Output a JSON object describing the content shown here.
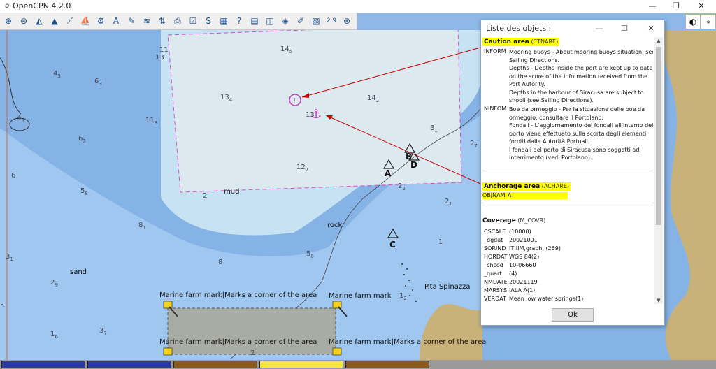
{
  "window": {
    "title": "OpenCPN 4.2.0",
    "minimize": "—",
    "restore": "❐",
    "close": "✕"
  },
  "toolbar": {
    "tools": [
      {
        "name": "zoom-in-icon",
        "glyph": "⊕"
      },
      {
        "name": "zoom-out-icon",
        "glyph": "⊖"
      },
      {
        "name": "scale-in-icon",
        "glyph": "◭"
      },
      {
        "name": "scale-out-icon",
        "glyph": "▲"
      },
      {
        "name": "route-icon",
        "glyph": "⟋"
      },
      {
        "name": "ship-icon",
        "glyph": "⛵"
      },
      {
        "name": "settings-icon",
        "glyph": "⚙"
      },
      {
        "name": "text-icon",
        "glyph": "A"
      },
      {
        "name": "pencil-icon",
        "glyph": "✎"
      },
      {
        "name": "tide-icon",
        "glyph": "≋"
      },
      {
        "name": "current-icon",
        "glyph": "⇅"
      },
      {
        "name": "print-icon",
        "glyph": "⎙"
      },
      {
        "name": "route-manager-icon",
        "glyph": "☑"
      },
      {
        "name": "track-icon",
        "glyph": "S"
      },
      {
        "name": "color-scheme-icon",
        "glyph": "▦"
      },
      {
        "name": "help-icon",
        "glyph": "?"
      },
      {
        "name": "layers-icon",
        "glyph": "▤"
      },
      {
        "name": "chart-display-icon",
        "glyph": "◫"
      },
      {
        "name": "ais-icon",
        "glyph": "◈"
      },
      {
        "name": "measure-icon",
        "glyph": "✐"
      },
      {
        "name": "chart-quilting-icon",
        "glyph": "▧"
      },
      {
        "name": "version-icon",
        "glyph": "2.9"
      },
      {
        "name": "mob-icon",
        "glyph": "⊛"
      }
    ],
    "compass_glyph": "◐",
    "gps_glyph": "⌖"
  },
  "chart": {
    "soundings": [
      {
        "t": "4",
        "s": "3"
      },
      {
        "t": "6",
        "s": "3"
      },
      {
        "t": "4",
        "s": "5"
      },
      {
        "t": "11",
        "s": "3"
      },
      {
        "t": "6",
        "s": "5"
      },
      {
        "t": "6",
        "s": ""
      },
      {
        "t": "5",
        "s": "8"
      },
      {
        "t": "8",
        "s": "1"
      },
      {
        "t": "11",
        "s": ""
      },
      {
        "t": "13",
        "s": ""
      },
      {
        "t": "14",
        "s": "5"
      },
      {
        "t": "13",
        "s": "4"
      },
      {
        "t": "14",
        "s": "2"
      },
      {
        "t": "13",
        "s": ""
      },
      {
        "t": "12",
        "s": "7"
      },
      {
        "t": "8",
        "s": "1"
      },
      {
        "t": "2",
        "s": "7"
      },
      {
        "t": "2",
        "s": "2"
      },
      {
        "t": "2",
        "s": "1"
      },
      {
        "t": "1",
        "s": ""
      },
      {
        "t": "5",
        "s": "8"
      },
      {
        "t": "8",
        "s": ""
      },
      {
        "t": "3",
        "s": "1"
      },
      {
        "t": "2",
        "s": "9"
      },
      {
        "t": "5",
        "s": ""
      },
      {
        "t": "1",
        "s": "6"
      },
      {
        "t": "3",
        "s": "7"
      },
      {
        "t": "1",
        "s": "2"
      },
      {
        "t": "2",
        "s": ""
      },
      {
        "t": "2",
        "s": ""
      }
    ],
    "place_labels": [
      "mud",
      "rock",
      "sand",
      "P.ta Spinazza"
    ],
    "beacons": [
      "A",
      "B",
      "D",
      "C"
    ],
    "mark_labels": [
      "Marine farm mark|Marks a corner of the area",
      "Marine farm mark",
      "Marine farm mark|Marks a corner of the area",
      "Marine farm mark|Marks a corner of the area"
    ],
    "colors": {
      "deep": "#c7e2f3",
      "mid": "#9fc7ef",
      "shallow": "#86b3e6",
      "land": "#c8b27a",
      "caution": "#dce9ef",
      "farm": "#a9aba5",
      "route": "#cc0000",
      "caution_line": "#d050c8"
    }
  },
  "statusbar": {
    "colors": [
      "#2b3aa0",
      "#2b3aa0",
      "#8b5a1a",
      "#f5e642",
      "#8b5a1a"
    ]
  },
  "dialog": {
    "title": "Liste des objets :",
    "minimize": "—",
    "maximize": "☐",
    "close": "✕",
    "caution": {
      "name": "Caution area",
      "code": "(CTNARE)",
      "inform_key": "INFORM",
      "inform": [
        "Mooring buoys - About mooring buoys situation, see",
        "Sailing Directions.",
        "Depths - Depths inside the port are kept up to date",
        "on the score of the information received from the",
        "Port Autority.",
        "Depths in the harbour of Siracusa are subject to",
        "shooll (see Sailing Directions)."
      ],
      "ninfom_key": "NINFOM",
      "ninfom": [
        "Boe da ormeggio - Per la situazione delle boe da",
        "ormeggio, consultare il Portolano.",
        "Fondali - L'aggiornamento dei fondali all'interno del",
        "porto viene effettuato sulla scorta degli elementi",
        "forniti dalle Autorità Portuali.",
        "I fondali del porto di Siracusa sono soggetti ad",
        "interrimento (vedi Portolano)."
      ]
    },
    "anchorage": {
      "name": "Anchorage area",
      "code": "(ACHARE)",
      "key": "OBJNAM",
      "value": "A"
    },
    "coverage": {
      "name": "Coverage",
      "code": "(M_COVR)",
      "rows": [
        {
          "k": "CSCALE",
          "v": "(10000)"
        },
        {
          "k": "_dgdat",
          "v": "20021001"
        },
        {
          "k": "SORIND",
          "v": "IT,IIM,graph, (269)"
        },
        {
          "k": "HORDAT",
          "v": "WGS 84(2)"
        },
        {
          "k": "_chcod",
          "v": "10-06660"
        },
        {
          "k": "_quart",
          "v": "(4)"
        },
        {
          "k": "NMDATE",
          "v": "20021119"
        },
        {
          "k": "MARSYS",
          "v": "IALA A(1)"
        },
        {
          "k": "VERDAT",
          "v": "Mean low water springs(1)"
        }
      ]
    },
    "ok_label": "Ok"
  }
}
